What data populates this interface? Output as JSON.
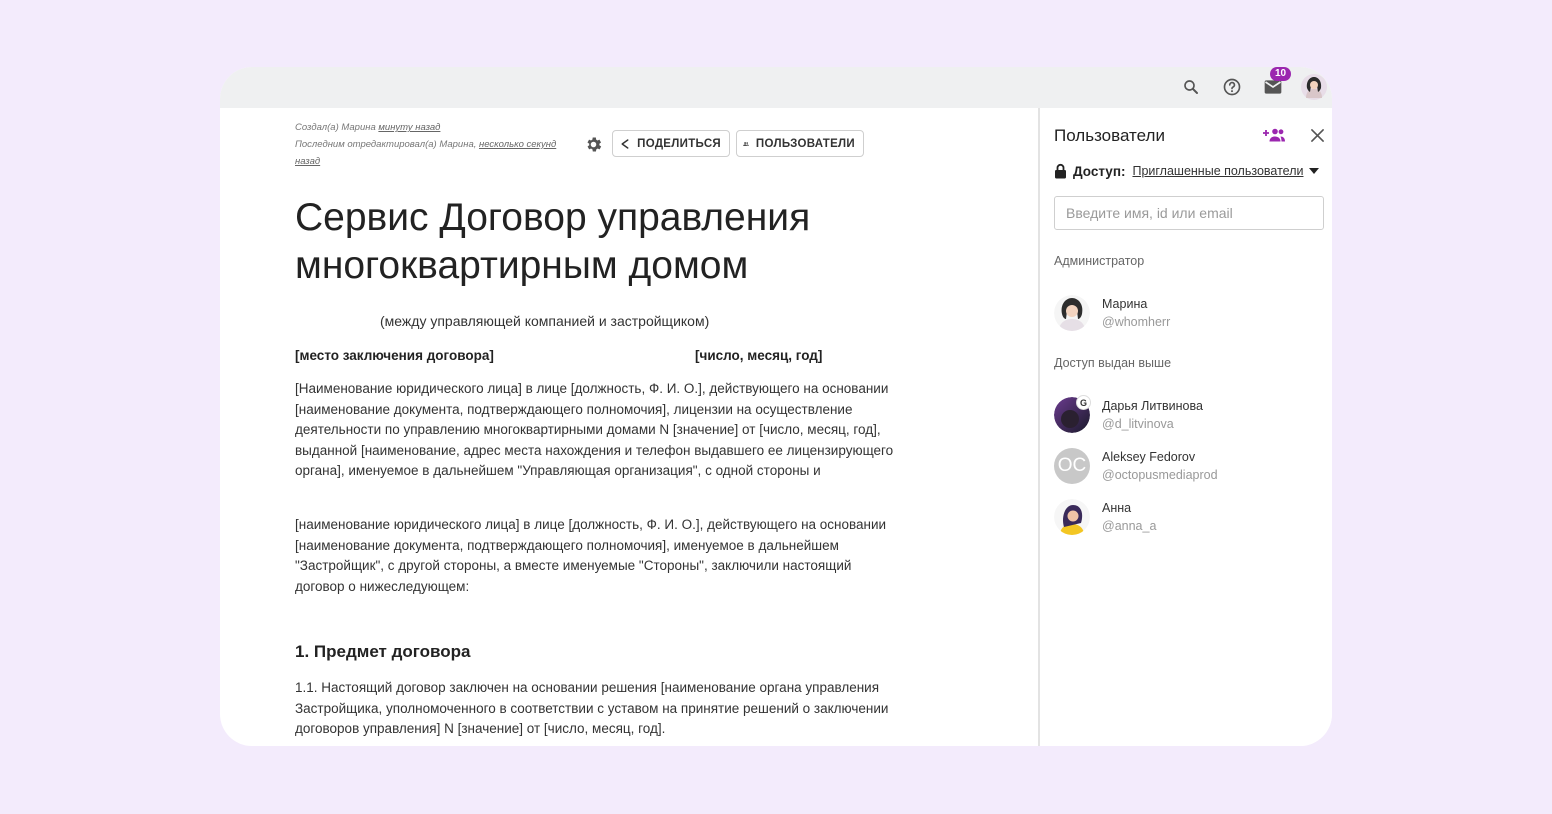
{
  "topbar": {
    "icons": [
      "search-icon",
      "help-icon",
      "mail-icon",
      "avatar"
    ],
    "mail_badge": "10"
  },
  "doc": {
    "meta": {
      "created_prefix": "Создал(а) Марина ",
      "created_link": "минуту назад",
      "edited_prefix": "Последним отредактировал(а) Марина, ",
      "edited_link": "несколько секунд назад"
    },
    "toolbar": {
      "share_label": "ПОДЕЛИТЬСЯ",
      "users_label": "ПОЛЬЗОВАТЕЛИ"
    },
    "title": "Сервис Договор управления многоквартирным домом",
    "subtitle": "(между управляющей компанией и застройщиком)",
    "place": "[место заключения договора]",
    "date": "[число, месяц, год]",
    "paragraph1": "[Наименование юридического лица] в лице [должность, Ф. И. О.], действующего на основании [наименование документа, подтверждающего полномочия], лицензии на осуществление деятельности по управлению многоквартирными домами N [значение] от [число, месяц, год], выданной [наименование, адрес места нахождения и телефон выдавшего ее лицензирующего органа], именуемое в дальнейшем \"Управляющая организация\", с одной стороны и",
    "paragraph2": "[наименование юридического лица] в лице [должность, Ф. И. О.], действующего на основании [наименование документа, подтверждающего полномочия], именуемое в дальнейшем \"Застройщик\", с другой стороны, а вместе именуемые \"Стороны\", заключили настоящий договор о нижеследующем:",
    "heading1": "1. Предмет договора",
    "paragraph3": "1.1. Настоящий договор заключен на основании решения [наименование органа управления Застройщика, уполномоченного в соответствии с уставом на принятие решений о заключении договоров управления] N [значение] от [число, месяц, год]."
  },
  "panel": {
    "title": "Пользователи",
    "access_label": "Доступ:",
    "access_value": "Приглашенные пользователи",
    "search_placeholder": "Введите имя, id или email",
    "admin_section": "Администратор",
    "inherited_section": "Доступ выдан выше",
    "admins": [
      {
        "name": "Марина",
        "handle": "@whomherr"
      }
    ],
    "users": [
      {
        "name": "Дарья Литвинова",
        "handle": "@d_litvinova",
        "badge": "G"
      },
      {
        "name": "Aleksey Fedorov",
        "handle": "@octopusmediaprod",
        "initials": "OC"
      },
      {
        "name": "Анна",
        "handle": "@anna_a"
      }
    ],
    "colors": {
      "accent": "#9b27af",
      "initials_bg": "#c8c8c8"
    }
  }
}
